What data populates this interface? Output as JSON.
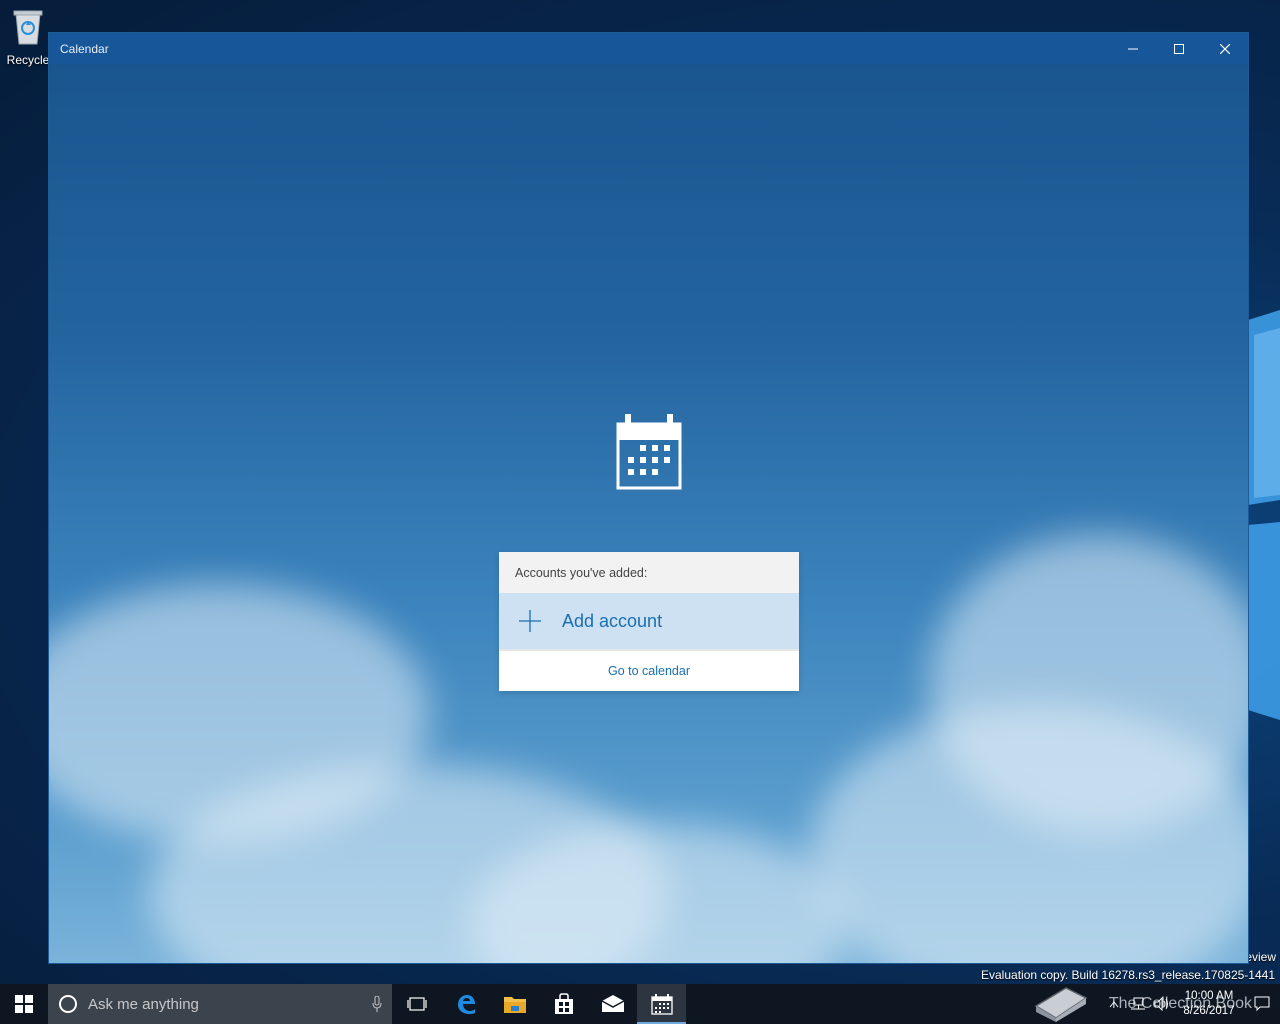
{
  "desktop": {
    "recycle_bin_label": "Recycle",
    "preview_text": "eview",
    "watermark": "Evaluation copy. Build 16278.rs3_release.170825-1441"
  },
  "window": {
    "title": "Calendar",
    "controls": {
      "minimize": "minimize-icon",
      "maximize": "maximize-icon",
      "close": "close-icon"
    }
  },
  "accounts_panel": {
    "header": "Accounts you've added:",
    "add_account": "Add account",
    "go_to_calendar": "Go to calendar"
  },
  "taskbar": {
    "search_placeholder": "Ask me anything",
    "pinned": [
      "task-view-icon",
      "edge-icon",
      "file-explorer-icon",
      "store-icon",
      "mail-icon",
      "calendar-icon"
    ],
    "active_app": "Calendar",
    "clock": {
      "time": "10:00 AM",
      "date": "8/26/2017"
    },
    "brand_text": "The Collection Book"
  },
  "colors": {
    "titlebar": "#175699",
    "accent": "#1a6fb2",
    "add_account_bg": "#cde1f2",
    "taskbar": "#0e1621"
  }
}
